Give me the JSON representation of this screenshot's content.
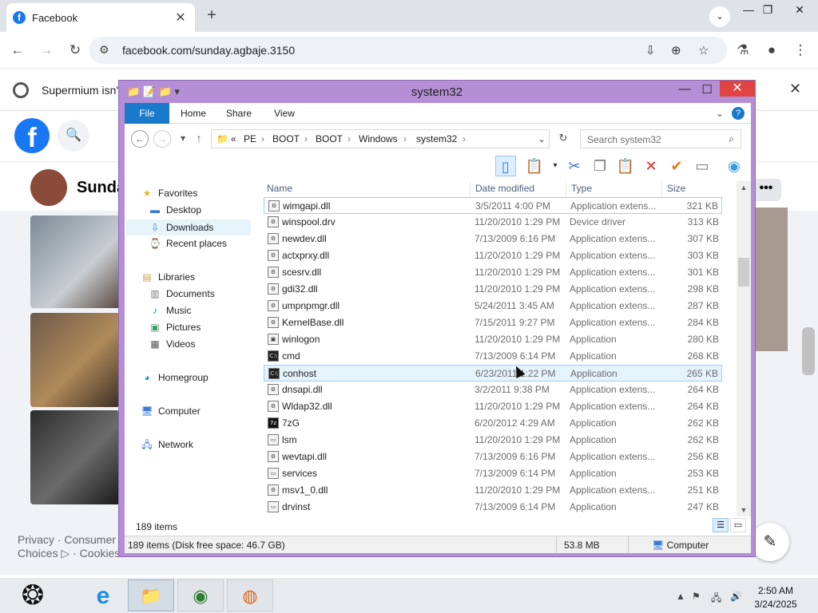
{
  "browser": {
    "tab_title": "Facebook",
    "tab_close": "✕",
    "new_tab": "+",
    "url": "facebook.com/sunday.agbaje.3150",
    "infobar_text": "Supermium isn't",
    "infobar_close": "✕"
  },
  "facebook": {
    "logo_letter": "f",
    "search_glyph": "🔍",
    "profile_name": "Sunda",
    "more_button": "•••",
    "footer_line1": "Privacy · Consumer",
    "footer_line2": "Choices ▷ · Cookies"
  },
  "explorer": {
    "title": "system32",
    "ribbon_tabs": [
      "File",
      "Home",
      "Share",
      "View"
    ],
    "address_crumbs": [
      "«",
      "PE",
      "BOOT",
      "BOOT",
      "Windows",
      "system32"
    ],
    "search_placeholder": "Search system32",
    "nav": {
      "favorites": "Favorites",
      "desktop": "Desktop",
      "downloads": "Downloads",
      "recent": "Recent places",
      "libraries": "Libraries",
      "documents": "Documents",
      "music": "Music",
      "pictures": "Pictures",
      "videos": "Videos",
      "homegroup": "Homegroup",
      "computer": "Computer",
      "network": "Network"
    },
    "columns": [
      "Name",
      "Date modified",
      "Type",
      "Size"
    ],
    "files": [
      {
        "name": "wimgapi.dll",
        "date": "3/5/2011 4:00 PM",
        "type": "Application extens...",
        "size": "321 KB",
        "icon": "dll-icon"
      },
      {
        "name": "winspool.drv",
        "date": "11/20/2010 1:29 PM",
        "type": "Device driver",
        "size": "313 KB",
        "icon": "drv-icon"
      },
      {
        "name": "newdev.dll",
        "date": "7/13/2009 6:16 PM",
        "type": "Application extens...",
        "size": "307 KB",
        "icon": "dll-icon"
      },
      {
        "name": "actxprxy.dll",
        "date": "11/20/2010 1:29 PM",
        "type": "Application extens...",
        "size": "303 KB",
        "icon": "dll-icon"
      },
      {
        "name": "scesrv.dll",
        "date": "11/20/2010 1:29 PM",
        "type": "Application extens...",
        "size": "301 KB",
        "icon": "dll-icon"
      },
      {
        "name": "gdi32.dll",
        "date": "11/20/2010 1:29 PM",
        "type": "Application extens...",
        "size": "298 KB",
        "icon": "dll-icon"
      },
      {
        "name": "umpnpmgr.dll",
        "date": "5/24/2011 3:45 AM",
        "type": "Application extens...",
        "size": "287 KB",
        "icon": "dll-icon"
      },
      {
        "name": "KernelBase.dll",
        "date": "7/15/2011 9:27 PM",
        "type": "Application extens...",
        "size": "284 KB",
        "icon": "dll-icon"
      },
      {
        "name": "winlogon",
        "date": "11/20/2010 1:29 PM",
        "type": "Application",
        "size": "280 KB",
        "icon": "winlogon-icon"
      },
      {
        "name": "cmd",
        "date": "7/13/2009 6:14 PM",
        "type": "Application",
        "size": "268 KB",
        "icon": "cmd-icon"
      },
      {
        "name": "conhost",
        "date": "6/23/2011 1:22 PM",
        "type": "Application",
        "size": "265 KB",
        "icon": "conhost-icon"
      },
      {
        "name": "dnsapi.dll",
        "date": "3/2/2011 9:38 PM",
        "type": "Application extens...",
        "size": "264 KB",
        "icon": "dll-icon"
      },
      {
        "name": "Wldap32.dll",
        "date": "11/20/2010 1:29 PM",
        "type": "Application extens...",
        "size": "264 KB",
        "icon": "dll-icon"
      },
      {
        "name": "7zG",
        "date": "6/20/2012 4:29 AM",
        "type": "Application",
        "size": "262 KB",
        "icon": "7zip-icon"
      },
      {
        "name": "lsm",
        "date": "11/20/2010 1:29 PM",
        "type": "Application",
        "size": "262 KB",
        "icon": "exe-icon"
      },
      {
        "name": "wevtapi.dll",
        "date": "7/13/2009 6:16 PM",
        "type": "Application extens...",
        "size": "256 KB",
        "icon": "dll-icon"
      },
      {
        "name": "services",
        "date": "7/13/2009 6:14 PM",
        "type": "Application",
        "size": "253 KB",
        "icon": "exe-icon"
      },
      {
        "name": "msv1_0.dll",
        "date": "11/20/2010 1:29 PM",
        "type": "Application extens...",
        "size": "251 KB",
        "icon": "dll-icon"
      },
      {
        "name": "drvinst",
        "date": "7/13/2009 6:14 PM",
        "type": "Application",
        "size": "247 KB",
        "icon": "exe-icon"
      }
    ],
    "item_count": "189 items",
    "status_disk": "189 items (Disk free space: 46.7 GB)",
    "status_size": "53.8 MB",
    "status_location": "Computer"
  },
  "taskbar": {
    "time": "2:50 AM",
    "date": "3/24/2025"
  },
  "colors": {
    "explorer_frame": "#b58fd6",
    "file_tab": "#1979ca",
    "close_button": "#e04343",
    "facebook_blue": "#1877f2",
    "selection": "#e5f3fb"
  }
}
